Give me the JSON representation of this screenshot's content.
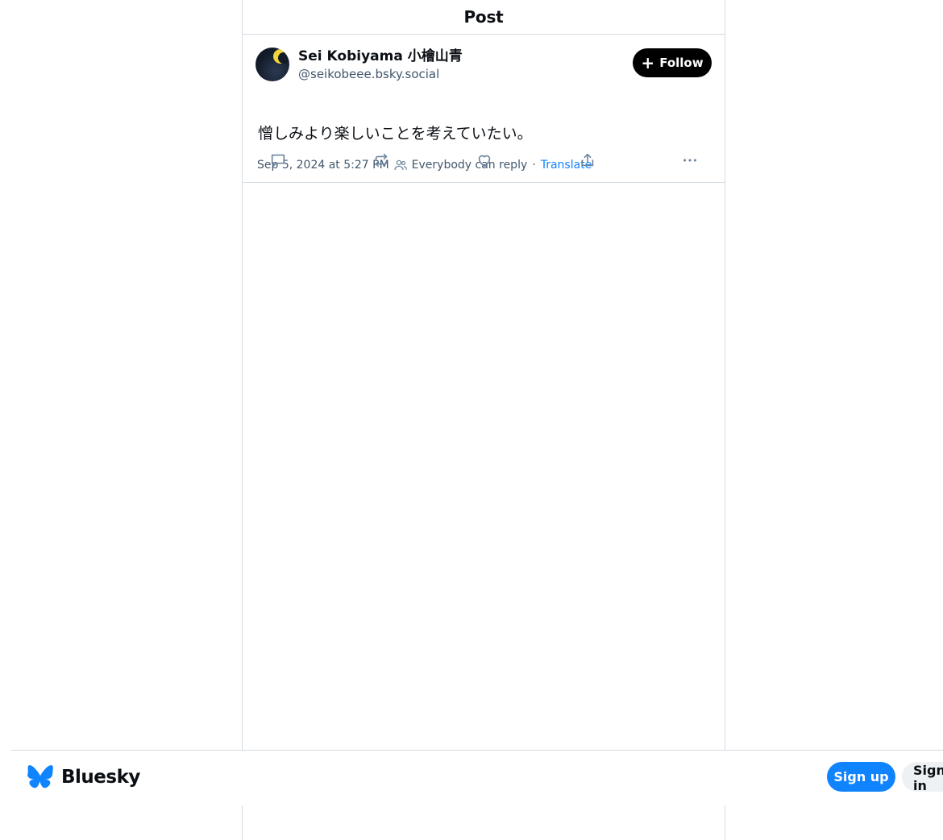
{
  "header": {
    "title": "Post"
  },
  "post": {
    "author": {
      "display_name": "Sei Kobiyama 小檜山青",
      "handle": "@seikobeee.bsky.social"
    },
    "follow_label": "Follow",
    "text": "憎しみより楽しいことを考えていたい。",
    "timestamp": "Sep 5, 2024 at 5:27 PM",
    "reply_setting": "Everybody can reply",
    "separator": "·",
    "translate_label": "Translate",
    "actions": [
      "reply-icon",
      "repost-icon",
      "like-icon",
      "share-icon",
      "more-icon"
    ]
  },
  "bottom_bar": {
    "brand_name": "Bluesky",
    "signup_label": "Sign up",
    "signin_label": "Sign in"
  },
  "colors": {
    "accent": "#1083fe",
    "border": "#d4dbe2",
    "muted_text": "#42576c",
    "icon": "#6f869f"
  }
}
